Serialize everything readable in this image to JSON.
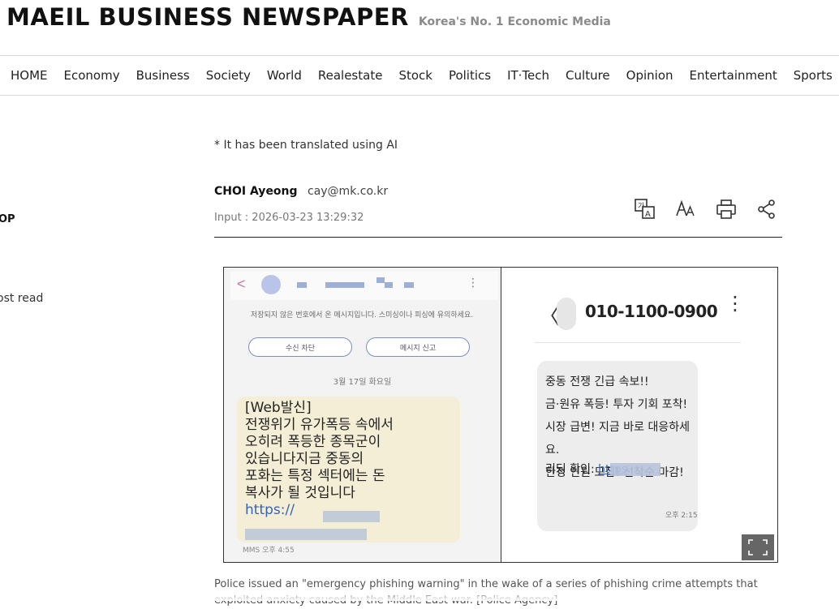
{
  "masthead": {
    "logo": "MAEIL BUSINESS NEWSPAPER",
    "tagline": "Korea's No. 1 Economic Media"
  },
  "nav": {
    "items": [
      "HOME",
      "Economy",
      "Business",
      "Society",
      "World",
      "Realestate",
      "Stock",
      "Politics",
      "IT·Tech",
      "Culture",
      "Opinion",
      "Entertainment",
      "Sports"
    ]
  },
  "sidebar": {
    "label_top": "OP",
    "label_most": "ost read"
  },
  "article": {
    "ai_note": "* It has been translated using AI",
    "author": "CHOI Ayeong",
    "email": "cay@mk.co.kr",
    "input_date": "Input : 2026-03-23 13:29:32",
    "caption": "Police issued an \"emergency phishing warning\" in the wake of a series of phishing crime attempts that exploited anxiety caused by the Middle East war. [Police Agency]"
  },
  "image": {
    "left": {
      "warning": "저장되지 않은 번호에서 온 메시지입니다. 스미싱이나 피싱에 유의하세요.",
      "btn_block": "수신 차단",
      "btn_report": "메시지 신고",
      "date": "3월 17일 화요일",
      "message": "[Web발신]\n전쟁위기 유가폭등 속에서\n오히려 폭등한 종목군이\n있습니다지금 중동의\n포화는 특정 섹터에는 돈\n복사가 될 것입니다",
      "link": "https://",
      "footer": "MMS 오후 4:55"
    },
    "right": {
      "phone": "010-1100-0900",
      "message": "중동 전쟁 긴급 속보!!\n금·원유 폭등! 투자 기회 포착!\n시장 급변! 지금 바로 대응하세요.\n한정 인원 모집! 선착순 마감!",
      "link_prefix": "리딩 확인: ",
      "link": "https",
      "time": "오후 2:15"
    }
  },
  "colors": {
    "link": "#3463b6",
    "divider": "#222222",
    "left_bubble": "#f4eed6",
    "right_bubble": "#ededed"
  },
  "icons": {
    "translate": "translate-icon",
    "font_size": "font-size-icon",
    "print": "print-icon",
    "share": "share-icon",
    "fullscreen": "fullscreen-icon"
  }
}
